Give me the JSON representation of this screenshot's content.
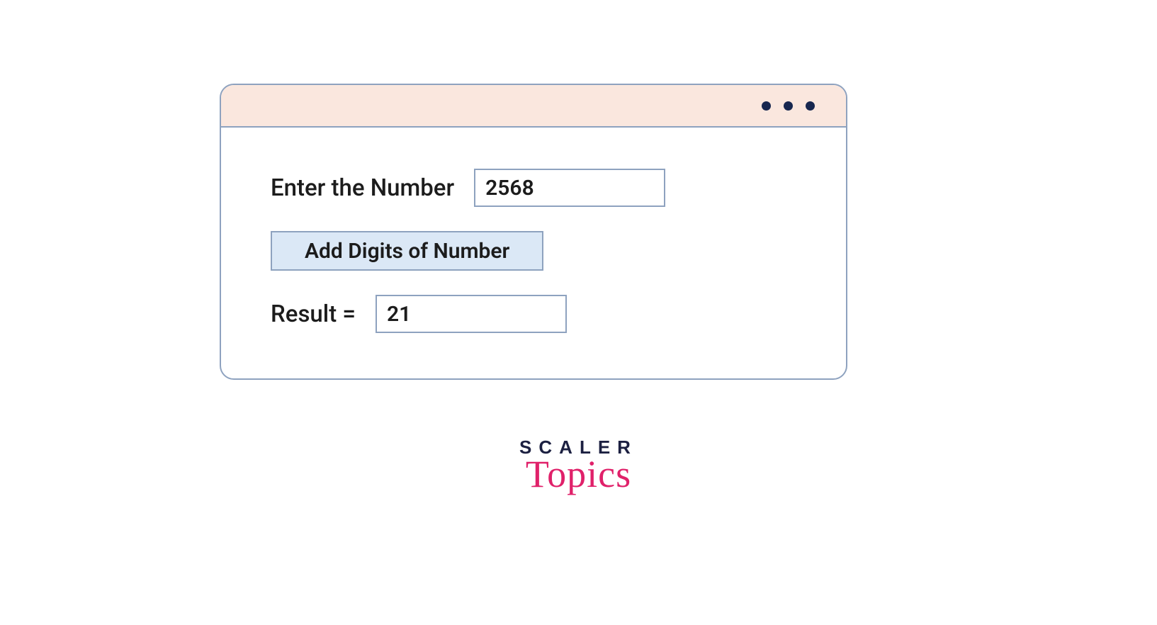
{
  "form": {
    "enter_label": "Enter the Number",
    "enter_value": "2568",
    "button_label": "Add Digits of Number",
    "result_label": "Result  =",
    "result_value": "21"
  },
  "logo": {
    "line1": "SCALER",
    "line2": "Topics"
  }
}
